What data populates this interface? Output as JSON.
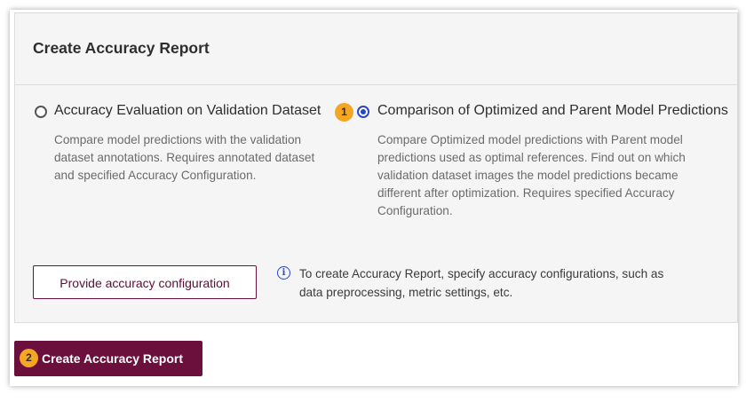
{
  "panel": {
    "title": "Create Accuracy Report"
  },
  "options": [
    {
      "title": "Accuracy Evaluation on Validation Dataset",
      "description": "Compare model predictions with the validation dataset annotations. Requires annotated dataset and specified Accuracy Configuration.",
      "selected": false
    },
    {
      "step": "1",
      "title": "Comparison of Optimized and Parent Model Predictions",
      "description": "Compare Optimized model predictions with Parent model predictions used as optimal references. Find out on which validation dataset images the model predictions became different after optimization. Requires specified Accuracy Configuration.",
      "selected": true
    }
  ],
  "config_button": {
    "label": "Provide accuracy configuration"
  },
  "info": {
    "icon": "info-icon",
    "text": "To create Accuracy Report, specify accuracy configurations, such as data preprocessing, metric settings, etc."
  },
  "create_button": {
    "step": "2",
    "label": "Create Accuracy Report"
  },
  "colors": {
    "primary": "#6b0f3c",
    "radio_selected": "#2748c4",
    "step_badge": "#f5a623",
    "panel_bg": "#f5f5f5"
  }
}
